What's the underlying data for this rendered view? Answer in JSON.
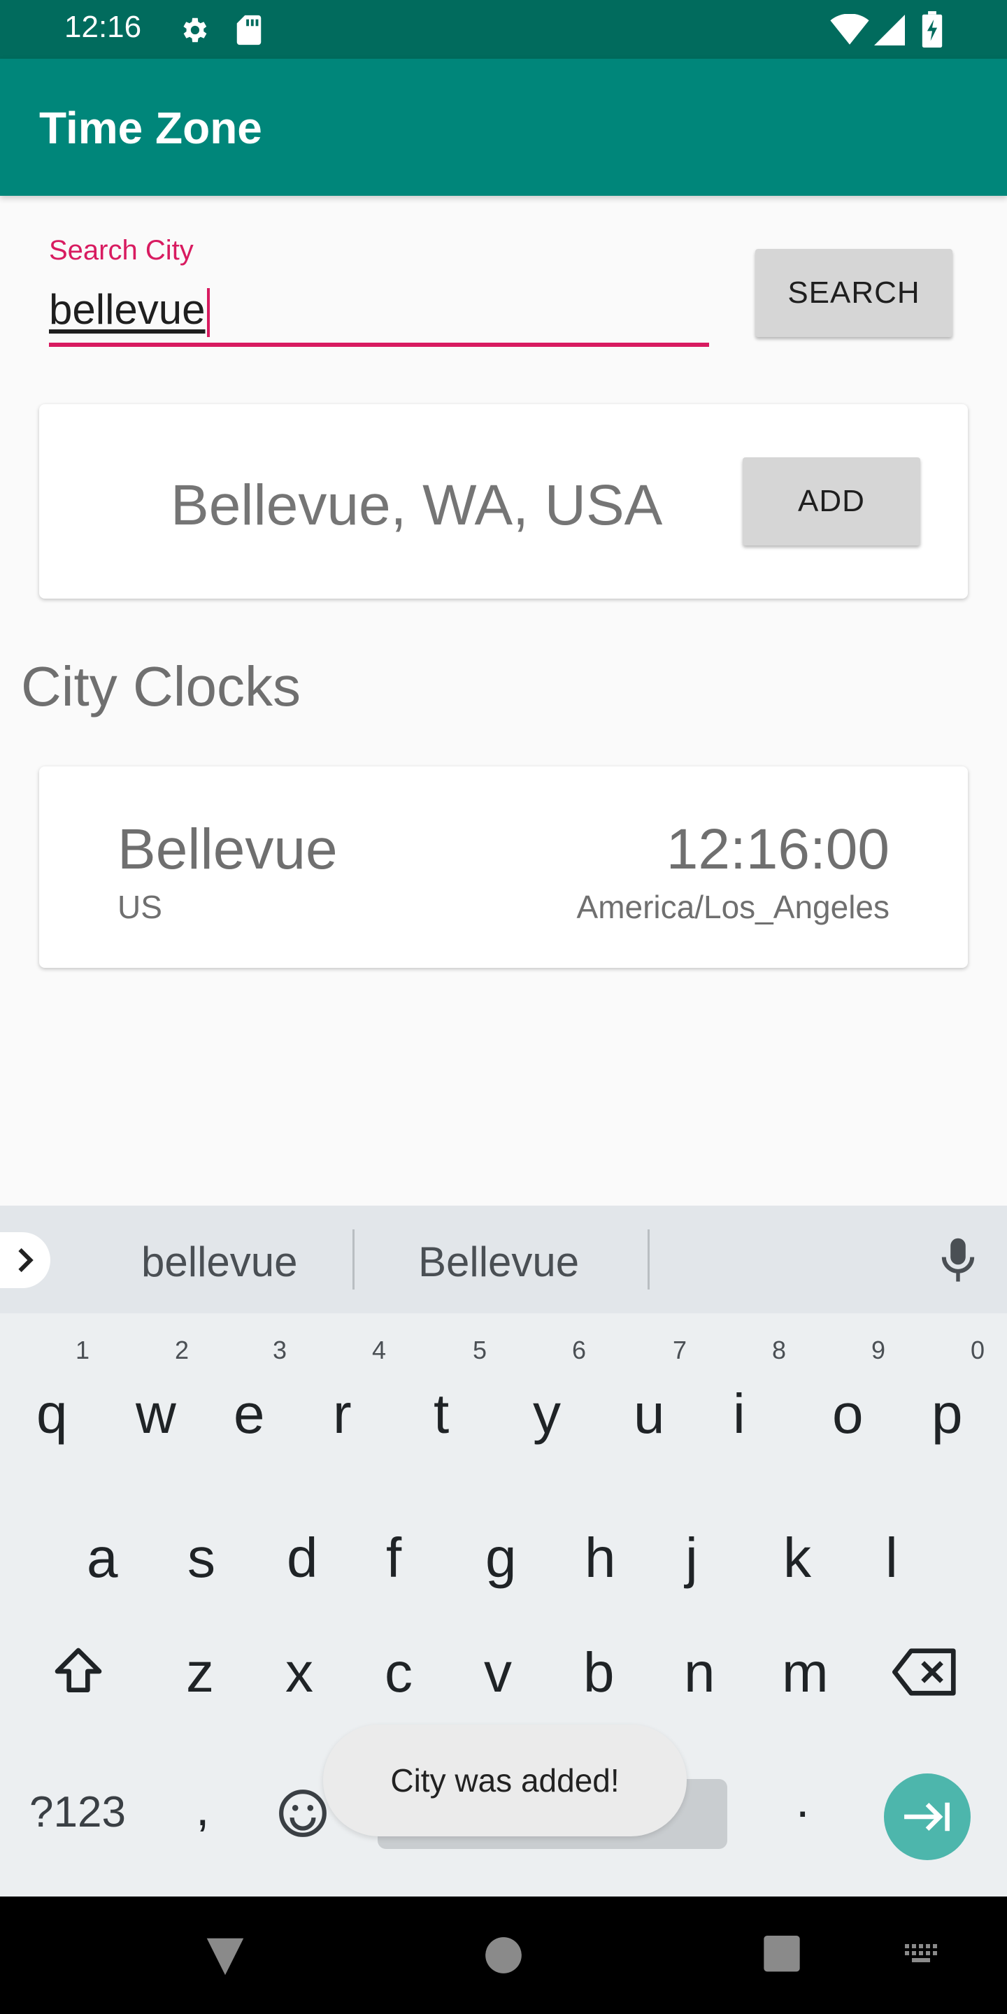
{
  "status_bar": {
    "time": "12:16",
    "icons": [
      "gear-icon",
      "sd-card-icon",
      "wifi-icon",
      "signal-icon",
      "battery-charging-icon"
    ]
  },
  "app_bar": {
    "title": "Time Zone"
  },
  "search": {
    "label": "Search City",
    "value": "bellevue",
    "button_label": "SEARCH"
  },
  "result": {
    "place": "Bellevue, WA, USA",
    "add_label": "ADD"
  },
  "city_clocks": {
    "title": "City Clocks",
    "items": [
      {
        "city": "Bellevue",
        "country": "US",
        "time": "12:16:00",
        "timezone": "America/Los_Angeles"
      }
    ]
  },
  "keyboard": {
    "suggestions": [
      "bellevue",
      "Bellevue"
    ],
    "row1": [
      "q",
      "w",
      "e",
      "r",
      "t",
      "y",
      "u",
      "i",
      "o",
      "p"
    ],
    "row1_hints": [
      "1",
      "2",
      "3",
      "4",
      "5",
      "6",
      "7",
      "8",
      "9",
      "0"
    ],
    "row2": [
      "a",
      "s",
      "d",
      "f",
      "g",
      "h",
      "j",
      "k",
      "l"
    ],
    "row3": [
      "z",
      "x",
      "c",
      "v",
      "b",
      "n",
      "m"
    ],
    "symbols_label": "?123",
    "comma": ",",
    "period": "."
  },
  "toast": {
    "message": "City was added!"
  },
  "colors": {
    "status_bar": "#016b5d",
    "app_bar": "#00867a",
    "accent": "#d81b60",
    "enter_key": "#4db6ac"
  }
}
